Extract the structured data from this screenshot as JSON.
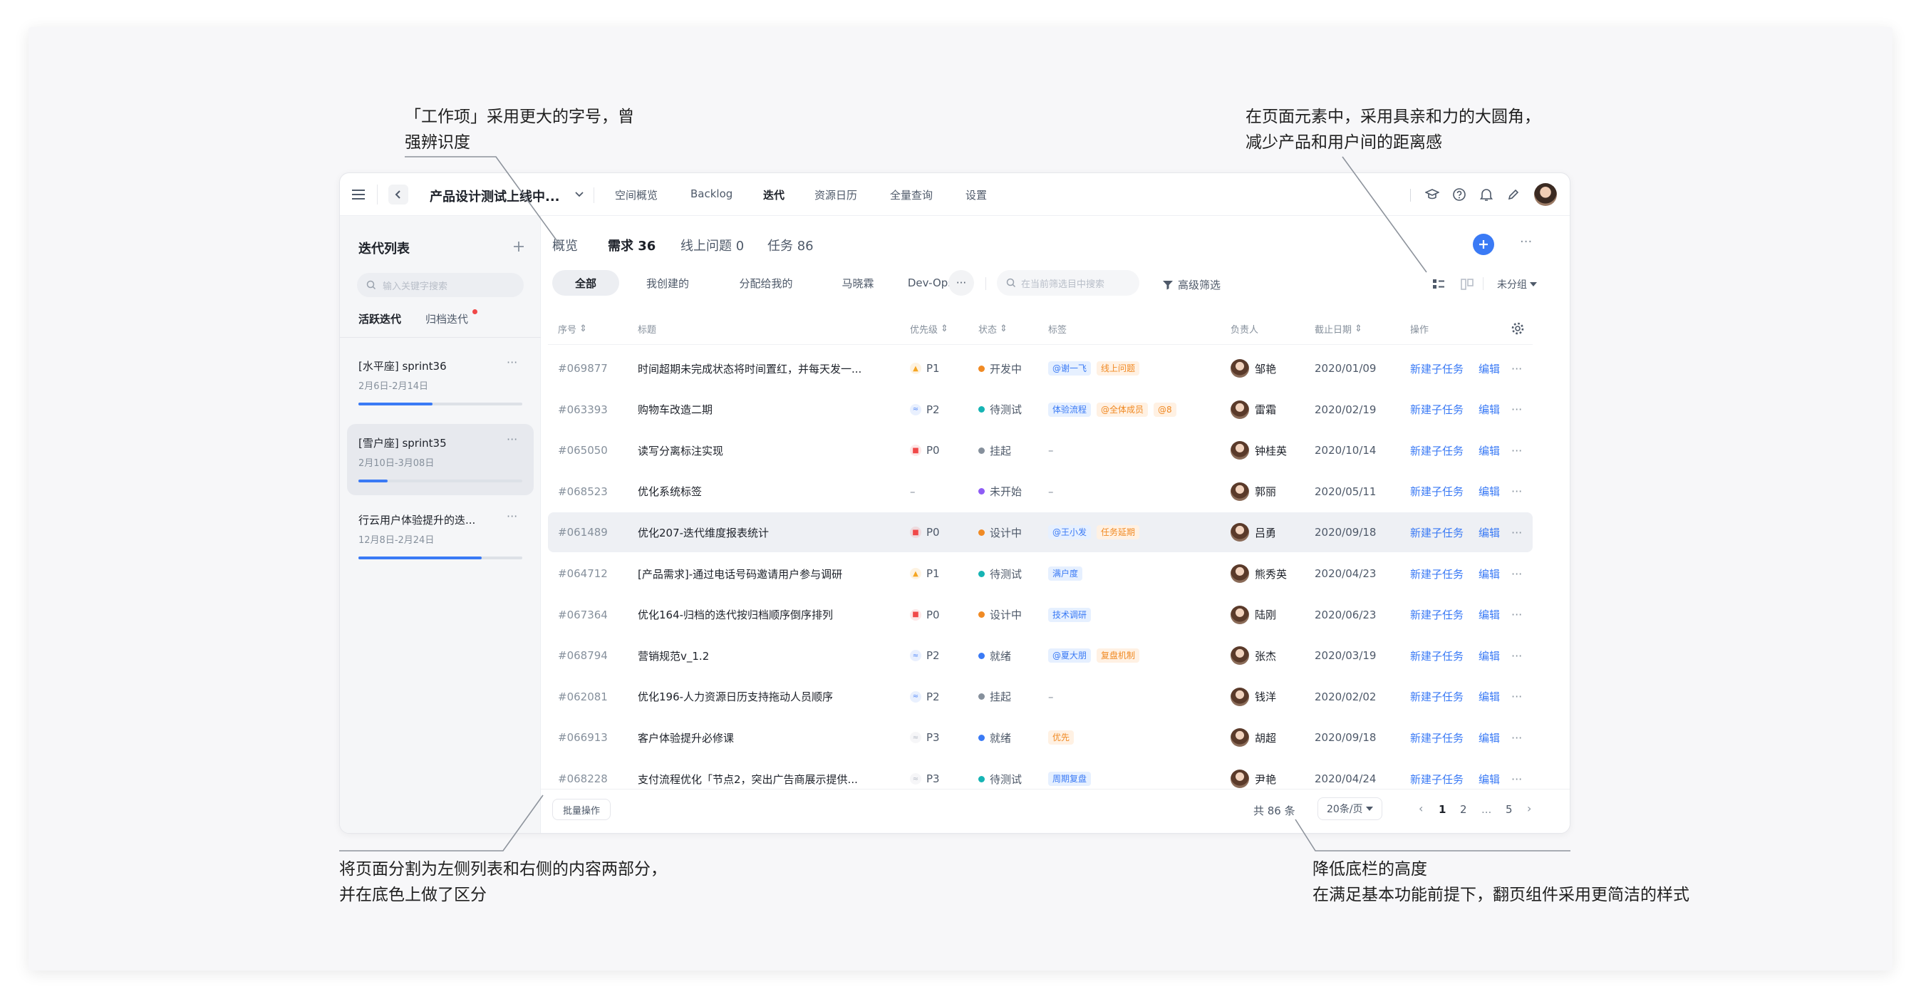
{
  "annotations": {
    "top_left": [
      "「工作项」采用更大的字号，曾",
      "强辨识度"
    ],
    "top_right": [
      "在页面元素中，采用具亲和力的大圆角，",
      "减少产品和用户间的距离感"
    ],
    "bottom_left": [
      "将页面分割为左侧列表和右侧的内容两部分，",
      "并在底色上做了区分"
    ],
    "bottom_right": [
      "降低底栏的高度",
      "在满足基本功能前提下，翻页组件采用更简洁的样式"
    ]
  },
  "topbar": {
    "project": "产品设计测试上线中...",
    "nav": [
      "空间概览",
      "Backlog",
      "迭代",
      "资源日历",
      "全量查询",
      "设置"
    ],
    "active_nav": "迭代"
  },
  "sidebar": {
    "title": "迭代列表",
    "search_placeholder": "输入关键字搜索",
    "tabs": [
      "活跃迭代",
      "归档迭代"
    ],
    "sprints": [
      {
        "name": "[水平座] sprint36",
        "date": "2月6日-2月14日",
        "progress": 0.45
      },
      {
        "name": "[雪户座] sprint35",
        "date": "2月10日-3月08日",
        "progress": 0.18
      },
      {
        "name": "行云用户体验提升的迭...",
        "date": "12月8日-2月24日",
        "progress": 0.75
      }
    ]
  },
  "main": {
    "tabs": [
      {
        "label": "概览",
        "count": ""
      },
      {
        "label": "需求",
        "count": "36"
      },
      {
        "label": "线上问题",
        "count": "0"
      },
      {
        "label": "任务",
        "count": "86"
      }
    ],
    "filters": [
      "全部",
      "我创建的",
      "分配给我的",
      "马晓霖",
      "Dev-Ops"
    ],
    "more": "···",
    "filter_search_placeholder": "在当前筛选目中搜索",
    "advanced_filter": "高级筛选",
    "group_label": "未分组"
  },
  "table": {
    "headers": [
      "序号",
      "标题",
      "优先级",
      "状态",
      "标签",
      "负责人",
      "截止日期",
      "操作"
    ],
    "rows": [
      {
        "id": "#069877",
        "title": "时间超期未完成状态将时间置红，并每天发一...",
        "priority": "P1",
        "status": "开发中",
        "status_color": "#f08a24",
        "tags": [
          {
            "t": "@谢一飞",
            "c": "blue"
          },
          {
            "t": "线上问题",
            "c": "orange"
          }
        ],
        "owner": "邹艳",
        "date": "2020/01/09",
        "highlight": false
      },
      {
        "id": "#063393",
        "title": "购物车改造二期",
        "priority": "P2",
        "status": "待测试",
        "status_color": "#16b4b4",
        "tags": [
          {
            "t": "体验流程",
            "c": "blue"
          },
          {
            "t": "@全体成员",
            "c": "orange"
          },
          {
            "t": "@8",
            "c": "orange"
          }
        ],
        "owner": "雷霜",
        "date": "2020/02/19",
        "highlight": false
      },
      {
        "id": "#065050",
        "title": "读写分离标注实现",
        "priority": "P0",
        "status": "挂起",
        "status_color": "#86909c",
        "tags": [],
        "owner": "钟桂英",
        "date": "2020/10/14",
        "highlight": false
      },
      {
        "id": "#068523",
        "title": "优化系统标签",
        "priority": "",
        "status": "未开始",
        "status_color": "#8e5cf5",
        "tags": [],
        "owner": "郭丽",
        "date": "2020/05/11",
        "highlight": false
      },
      {
        "id": "#061489",
        "title": "优化207-迭代维度报表统计",
        "priority": "P0",
        "status": "设计中",
        "status_color": "#f08a24",
        "tags": [
          {
            "t": "@王小发",
            "c": "blue"
          },
          {
            "t": "任务延期",
            "c": "orange"
          }
        ],
        "owner": "吕勇",
        "date": "2020/09/18",
        "highlight": true
      },
      {
        "id": "#064712",
        "title": "[产品需求]-通过电话号码邀请用户参与调研",
        "priority": "P1",
        "status": "待测试",
        "status_color": "#16b4b4",
        "tags": [
          {
            "t": "满户度",
            "c": "blue"
          }
        ],
        "owner": "熊秀英",
        "date": "2020/04/23",
        "highlight": false
      },
      {
        "id": "#067364",
        "title": "优化164-归档的迭代按归档顺序倒序排列",
        "priority": "P0",
        "status": "设计中",
        "status_color": "#f08a24",
        "tags": [
          {
            "t": "技术调研",
            "c": "blue"
          }
        ],
        "owner": "陆刚",
        "date": "2020/06/23",
        "highlight": false
      },
      {
        "id": "#068794",
        "title": "营销规范v_1.2",
        "priority": "P2",
        "status": "就绪",
        "status_color": "#3a7af5",
        "tags": [
          {
            "t": "@夏大朋",
            "c": "blue"
          },
          {
            "t": "复盘机制",
            "c": "orange"
          }
        ],
        "owner": "张杰",
        "date": "2020/03/19",
        "highlight": false
      },
      {
        "id": "#062081",
        "title": "优化196-人力资源日历支持拖动人员顺序",
        "priority": "P2",
        "status": "挂起",
        "status_color": "#86909c",
        "tags": [],
        "owner": "钱洋",
        "date": "2020/02/02",
        "highlight": false
      },
      {
        "id": "#066913",
        "title": "客户体验提升必修课",
        "priority": "P3",
        "status": "就绪",
        "status_color": "#3a7af5",
        "tags": [
          {
            "t": "优先",
            "c": "orange"
          }
        ],
        "owner": "胡超",
        "date": "2020/09/18",
        "highlight": false
      },
      {
        "id": "#068228",
        "title": "支付流程优化「节点2，突出广告商展示提供...",
        "priority": "P3",
        "status": "待测试",
        "status_color": "#16b4b4",
        "tags": [
          {
            "t": "周期复盘",
            "c": "blue"
          }
        ],
        "owner": "尹艳",
        "date": "2020/04/24",
        "highlight": false
      }
    ],
    "action_new": "新建子任务",
    "action_edit": "编辑"
  },
  "footer": {
    "batch": "批量操作",
    "total": "共 86 条",
    "page_size": "20条/页",
    "pages": [
      "1",
      "2",
      "...",
      "5"
    ]
  },
  "colors": {
    "accent": "#3a7af5",
    "P0": "#f04848",
    "P1": "#f5a623",
    "P2": "#5b8ff9",
    "P3": "#b8bec8"
  }
}
